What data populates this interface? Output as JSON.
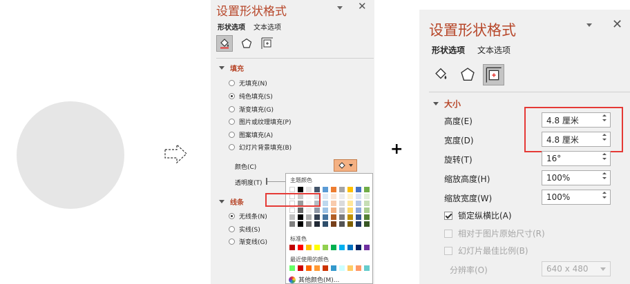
{
  "colors": {
    "accent": "#b7472a",
    "highlight": "#e53935",
    "circle": "#e6e6e6",
    "pane_bg": "#f0f0f0"
  },
  "pane1": {
    "title": "设置形状格式",
    "tabs": {
      "shape": "形状选项",
      "text": "文本选项"
    },
    "icons": [
      "fill-line-icon",
      "effects-pentagon-icon",
      "size-properties-icon"
    ],
    "fill": {
      "heading": "填充",
      "options": [
        {
          "label": "无填充(N)",
          "checked": false
        },
        {
          "label": "纯色填充(S)",
          "checked": true
        },
        {
          "label": "渐变填充(G)",
          "checked": false
        },
        {
          "label": "图片或纹理填充(P)",
          "checked": false
        },
        {
          "label": "图案填充(A)",
          "checked": false
        },
        {
          "label": "幻灯片背景填充(B)",
          "checked": false
        }
      ],
      "color_label": "颜色(C)",
      "transparency_label": "透明度(T)"
    },
    "line": {
      "heading": "线条",
      "options": [
        {
          "label": "无线条(N)",
          "checked": true
        },
        {
          "label": "实线(S)",
          "checked": false
        },
        {
          "label": "渐变线(G)",
          "checked": false
        }
      ]
    }
  },
  "color_dropdown": {
    "theme_heading": "主题颜色",
    "theme_top": [
      "#ffffff",
      "#000000",
      "#e7e6e6",
      "#44546a",
      "#5b9bd5",
      "#ed7d31",
      "#a5a5a5",
      "#ffc000",
      "#4472c4",
      "#70ad47"
    ],
    "standard_heading": "标准色",
    "standard": [
      "#c00000",
      "#ff0000",
      "#ffc000",
      "#ffff00",
      "#92d050",
      "#00b050",
      "#00b0f0",
      "#0070c0",
      "#002060",
      "#7030a0"
    ],
    "recent_heading": "最近使用的颜色",
    "recent": [
      "#66ff66",
      "#cc0000",
      "#ff6600",
      "#ff9933",
      "#cc3300",
      "#3399cc",
      "#ccffff",
      "#ffcc66",
      "#ff9966",
      "#66cccc"
    ],
    "more_label": "其他颜色(M)..."
  },
  "pane2": {
    "title": "设置形状格式",
    "tabs": {
      "shape": "形状选项",
      "text": "文本选项"
    },
    "size_heading": "大小",
    "height": {
      "label": "高度(E)",
      "value": "4.8 厘米"
    },
    "width": {
      "label": "宽度(D)",
      "value": "4.8 厘米"
    },
    "rotation": {
      "label": "旋转(T)",
      "value": "16°"
    },
    "scale_height": {
      "label": "缩放高度(H)",
      "value": "100%"
    },
    "scale_width": {
      "label": "缩放宽度(W)",
      "value": "100%"
    },
    "lock_aspect": {
      "label": "锁定纵横比(A)",
      "checked": true
    },
    "relative_original": {
      "label": "相对于图片原始尺寸(R)",
      "checked": false
    },
    "best_scale": {
      "label": "幻灯片最佳比例(B)",
      "checked": false
    },
    "resolution": {
      "label": "分辨率(O)",
      "value": "640 x 480"
    }
  },
  "plus_sign": "+"
}
